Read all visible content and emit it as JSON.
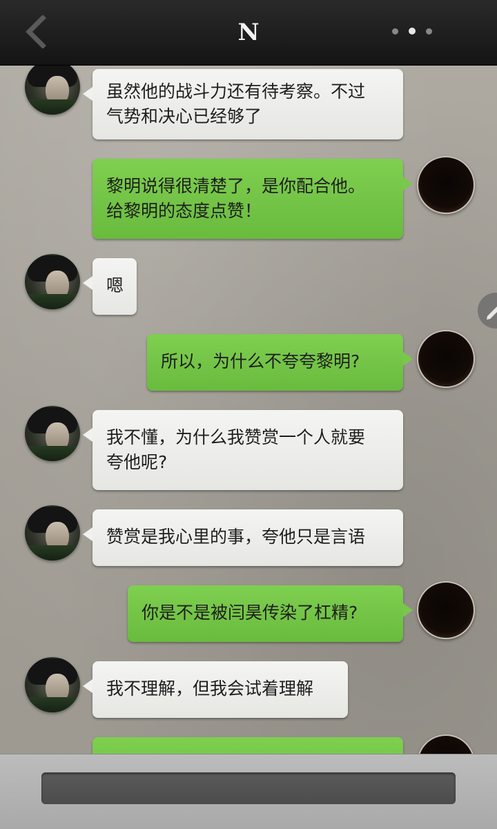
{
  "header": {
    "title": "N",
    "back_icon": "chevron-left-icon",
    "menu_icon": "more-dots-icon"
  },
  "messages": [
    {
      "side": "left",
      "lines": [
        "虽然他的战斗力还有待考察。不过",
        "气势和决心已经够了"
      ]
    },
    {
      "side": "right",
      "lines": [
        "黎明说得很清楚了，是你配合他。",
        "给黎明的态度点赞！"
      ]
    },
    {
      "side": "left",
      "lines": [
        "嗯"
      ]
    },
    {
      "side": "right",
      "lines": [
        "所以，为什么不夸夸黎明?"
      ]
    },
    {
      "side": "left",
      "lines": [
        "我不懂，为什么我赞赏一个人就要",
        "夸他呢?"
      ]
    },
    {
      "side": "left",
      "lines": [
        "赞赏是我心里的事，夸他只是言语"
      ]
    },
    {
      "side": "right",
      "lines": [
        "你是不是被闫昊传染了杠精?"
      ]
    },
    {
      "side": "left",
      "lines": [
        "我不理解，但我会试着理解"
      ]
    },
    {
      "side": "right",
      "lines": [
        ""
      ]
    }
  ],
  "input": {
    "placeholder": ""
  },
  "colors": {
    "outgoing_bubble": "#73c446",
    "incoming_bubble": "#eeeeec",
    "header_bg": "#1c1c1c"
  }
}
